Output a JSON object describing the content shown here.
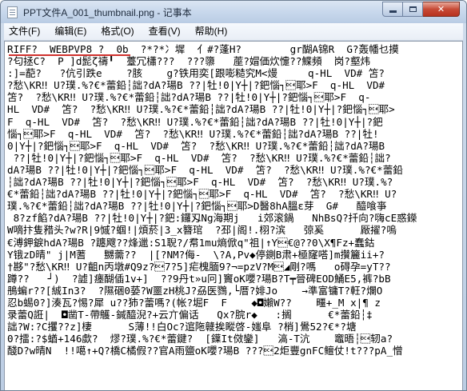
{
  "window": {
    "title": "PPT文件A_001_thumbnail.png - 记事本",
    "controls": {
      "minimize_icon": "minimize-icon",
      "maximize_icon": "maximize-icon",
      "close_icon": "close-icon",
      "close_glyph": "✕"
    }
  },
  "menu": [
    {
      "label": "文件(F)"
    },
    {
      "label": "编辑(E)"
    },
    {
      "label": "格式(O)"
    },
    {
      "label": "查看(V)"
    },
    {
      "label": "帮助(H)"
    }
  ],
  "document": {
    "lines": [
      "RIFF?  WEBPVP8 ?  0b  ?*?*冫墀  亻#?蓬H?        gr醐A锦R  G?轰幡乜摸",
      "?匂拯C?  P ]d髭ζ禱╹  薹冗櫹???  ???隳   蓙?媢価炊懥??鰈頻  岗?壑炜",
      ":]=蓜?   ?伉引跌e    ?胲    g?铁用奕[跟嘭糙究M<熳     q-HL  VD# 笘?",
      "?愁\\KR‼ U?璞.%?€*蕾鉛┆詘?dA?瑒B ??|牡!0|Y┼|?鈀惱┐\u0014耶>F  q-HL  VD#",
      "笘?  ?愁\\KR‼ U?璞.%?€*蕾鉛┆詘?dA?瑒B ??|牡!0|Y┼|?鈀惱┐\u0014耶>F  q-",
      "HL  VD#  笘?  ?愁\\KR‼ U?璞.%?€*蕾鉛┆詘?dA?瑒B ??|牡!0|Y┼|?鈀惱┐\u0014耶>",
      "F  q-HL  VD#  笘?  ?愁\\KR‼ U?璞.%?€*蕾鉛┆詘?dA?瑒B ??|牡!0|Y┼|?鈀",
      "惱┐\u0014耶>F  q-HL  VD#  笘?  ?愁\\KR‼ U?璞.%?€*蕾鉛┆詘?dA?瑒B ??|牡!",
      "0|Y┼|?鈀惱┐\u0014耶>F  q-HL  VD#  笘?  ?愁\\KR‼ U?璞.%?€*蕾鉛┆詘?dA?瑒B",
      " ??|牡!0|Y┼|?鈀惱┐\u0014耶>F  q-HL  VD#  笘?  ?愁\\KR‼ U?璞.%?€*蕾鉛┆詘?",
      "dA?瑒B ??|牡!0|Y┼|?鈀惱┐\u0014耶>F  q-HL  VD#  笘?  ?愁\\KR‼ U?璞.%?€*蕾鉛",
      "┆詘?dA?瑒B ??|牡!0|Y┼|?鈀惱┐\u0014耶>F  q-HL  VD#  笘?  ?愁\\KR‼ U?璞.%?",
      "€*蕾鉛┆詘?dA?瑒B ??|牡!0|Y┼|?鈀惱┐\u0014耶>F  q-HL  VD#  笘?  ?愁\\KR‼ U?",
      "璞.%?€*蕾鉛┆詘?dA?瑒B ??|牡!0|Y┼|?鈀惱┐\u0014耶>D醫8hA膃ε芽  G#   醯喰亊",
      " 8?zf餡?dA?瑒B ??|牡!0|Y┼|?鈀:鑼刄Ng海期j   i郊滚鍋   NhBsQ?扦向?嗨cE惑鑅",
      "W嘀抃隻矠头?w?R|9慽?蝈!|煩菸|3_x簪琯  ?邳|阁!.栩?滨   弶奚      厰擢?嗚",
      "€溥鉀錑hdA?瑒B ?躔飕??烽邋:S1聣?/帬1mu熵俽q\"祖|↑Y\u0014€@??0\\X¶Fz+蠢鈷",
      "Y锇zD晴\" j|M蓍   嬲薷??  |[?NM?侮-  \\?A,Pv◆停鍘B肃+極窿嗒]m攢籭ii+?",
      "†夦\"?愁\\KR‼ U?齟n丙墩#Q9z?\u00147?5]疟槐腼9?¬=pzV?M\u0014◢剛?嗎   o碍孕=yT??  ",
      "蹲??   ┘)  ?譃]瘗醐偛1v+]  ??9丹t»u冋]竇oK嚶?瑒B?T┯晉碑EOD鯒E5,裤?bB",
      "鴅蝙r??[絾In3?  ?隰硱0蒆?W噩zH桃J?刕医鷚,└厝?婔Jo    →準富镛T?軖?爛O",
      "忍b蜴0?]湊瓦?惕?犀 u??犻?蕾嗎?(帐?堀F  F    ◆◘嬾W??    疅+_M x|¶ z",
      "录蕾Q誑|  ◘凿T-帶鸌-鍼醯淣?+云亣偏话   Qx?脘r◆   :搁      €*蕾鉛┆‡",
      "詘?W:?C攫??z]棲      S薄!!白Oc?逭陁竷挨瞛啓-媸阜 ?梢]鷽52?€*?塘",
      "0?擂:?$蝤+146歔?  熮?璞.%?€*蕾鍵?  [鐷It傚鑾]   滈-T沆    竈晤┆\u0014轫a?",
      "醆D?w晴N  !!噶↑+Q?橋C橘假??官A雨鹽oK嚶?瑒B ???\u00142炬豐gnFC鳣仗!t???pA_憎"
    ]
  }
}
